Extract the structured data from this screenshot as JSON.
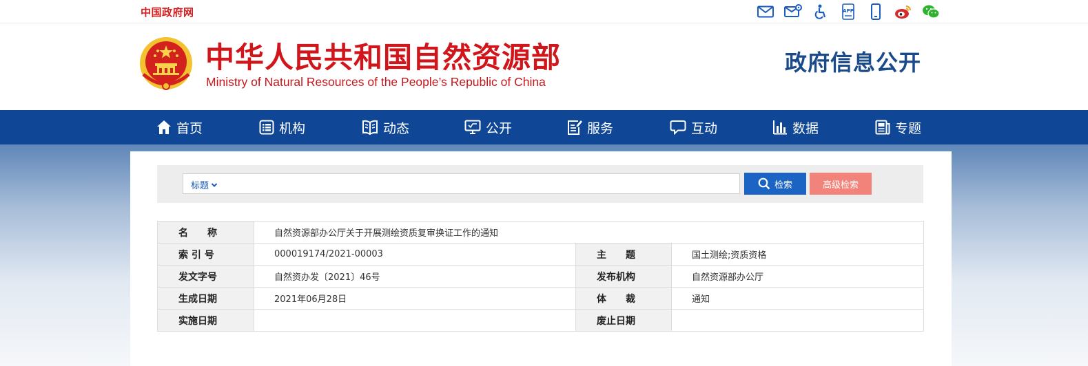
{
  "topbar": {
    "gov_link": "中国政府网",
    "icons": [
      "mail-icon",
      "mail-settings-icon",
      "accessibility-icon",
      "app-icon",
      "mobile-icon",
      "weibo-icon",
      "wechat-icon"
    ],
    "app_icon_text": "APP"
  },
  "header": {
    "ministry_cn": "中华人民共和国自然资源部",
    "ministry_en": "Ministry of Natural Resources of the People’s Republic of China",
    "info_title": "政府信息公开"
  },
  "nav": {
    "items": [
      {
        "label": "首页",
        "icon": "home-icon"
      },
      {
        "label": "机构",
        "icon": "organization-icon"
      },
      {
        "label": "动态",
        "icon": "book-icon"
      },
      {
        "label": "公开",
        "icon": "monitor-icon"
      },
      {
        "label": "服务",
        "icon": "document-edit-icon"
      },
      {
        "label": "互动",
        "icon": "chat-icon"
      },
      {
        "label": "数据",
        "icon": "bar-chart-icon"
      },
      {
        "label": "专题",
        "icon": "newspaper-icon"
      }
    ]
  },
  "search": {
    "select_value": "标题",
    "input_value": "",
    "search_label": "检索",
    "advanced_label": "高级检索"
  },
  "meta": {
    "name_label": "名　　称",
    "name_value": "自然资源部办公厅关于开展测绘资质复审换证工作的通知",
    "index_label": "索 引 号",
    "index_value": "000019174/2021-00003",
    "topic_label": "主　　题",
    "topic_value": "国土测绘;资质资格",
    "docno_label": "发文字号",
    "docno_value": "自然资办发〔2021〕46号",
    "publisher_label": "发布机构",
    "publisher_value": "自然资源部办公厅",
    "created_label": "生成日期",
    "created_value": "2021年06月28日",
    "genre_label": "体　　裁",
    "genre_value": "通知",
    "effective_label": "实施日期",
    "effective_value": "",
    "expiry_label": "废止日期",
    "expiry_value": ""
  },
  "colors": {
    "brand_red": "#d0161b",
    "nav_blue": "#0f4796",
    "search_blue": "#1b64c4",
    "advanced_salmon": "#f2837a",
    "title_blue": "#1a4a8a"
  }
}
